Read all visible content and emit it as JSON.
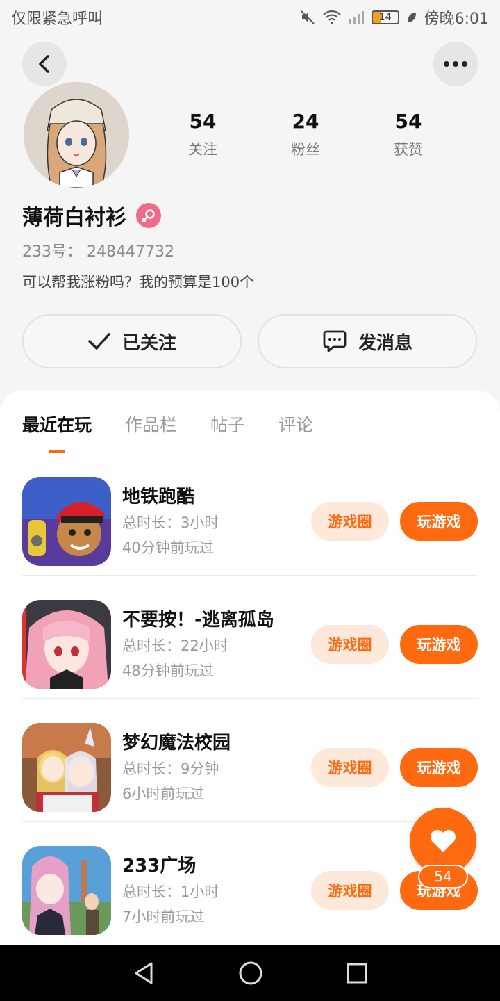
{
  "status_bar": {
    "left_text": "仅限紧急呼叫",
    "battery": "14",
    "time": "傍晚6:01"
  },
  "profile": {
    "stats": [
      {
        "value": "54",
        "label": "关注"
      },
      {
        "value": "24",
        "label": "粉丝"
      },
      {
        "value": "54",
        "label": "获赞"
      }
    ],
    "username": "薄荷白衬衫",
    "account_id": "233号：  248447732",
    "bio": "可以帮我涨粉吗？我的预算是100个",
    "follow_label": "已关注",
    "message_label": "发消息"
  },
  "tabs": [
    {
      "label": "最近在玩",
      "active": true
    },
    {
      "label": "作品栏",
      "active": false
    },
    {
      "label": "帖子",
      "active": false
    },
    {
      "label": "评论",
      "active": false
    }
  ],
  "games": [
    {
      "name": "地铁跑酷",
      "duration": "总时长：3小时",
      "last_played": "40分钟前玩过",
      "community_label": "游戏圈",
      "play_label": "玩游戏"
    },
    {
      "name": "不要按！-逃离孤岛",
      "duration": "总时长：22小时",
      "last_played": "48分钟前玩过",
      "community_label": "游戏圈",
      "play_label": "玩游戏"
    },
    {
      "name": "梦幻魔法校园",
      "duration": "总时长：9分钟",
      "last_played": "6小时前玩过",
      "community_label": "游戏圈",
      "play_label": "玩游戏"
    },
    {
      "name": "233广场",
      "duration": "总时长：1小时",
      "last_played": "7小时前玩过",
      "community_label": "游戏圈",
      "play_label": "玩游戏"
    }
  ],
  "like_fab": {
    "count": "54"
  },
  "colors": {
    "accent": "#ff6a10",
    "accent_light": "#fde8da",
    "background": "#f5f5f5"
  }
}
